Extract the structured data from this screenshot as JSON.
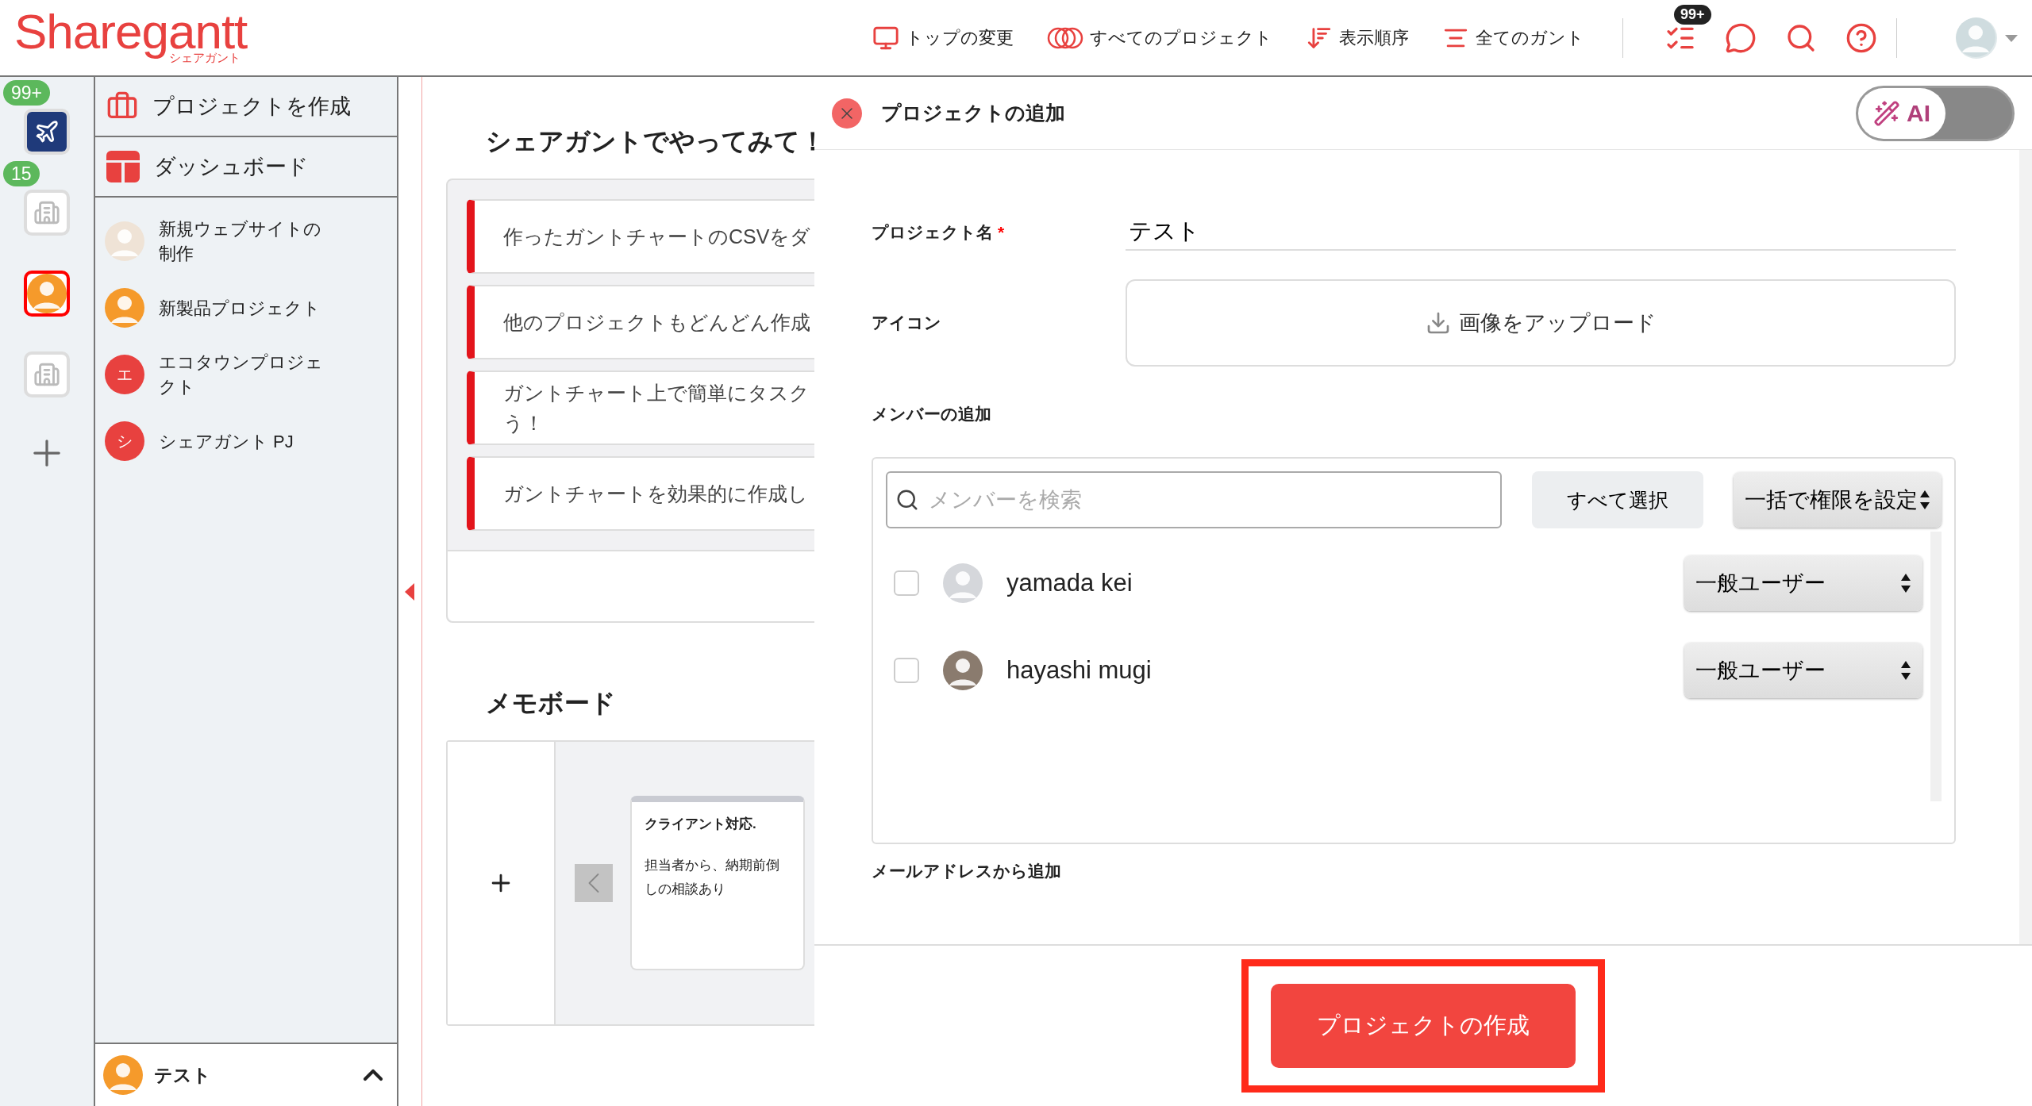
{
  "header": {
    "logo": {
      "name": "Sharegantt",
      "sub": "シェアガント"
    },
    "nav": [
      {
        "label": "トップの変更"
      },
      {
        "label": "すべてのプロジェクト"
      },
      {
        "label": "表示順序"
      },
      {
        "label": "全てのガント"
      }
    ],
    "tools": [
      {
        "badge": "99+"
      }
    ]
  },
  "rail": {
    "items": [
      {
        "kind": "plane",
        "badge": "99+",
        "selected": false
      },
      {
        "kind": "building",
        "badge": "15",
        "selected": false
      },
      {
        "kind": "character",
        "selected": true
      },
      {
        "kind": "building",
        "selected": false
      }
    ]
  },
  "sidebar": {
    "actions": [
      {
        "label": "プロジェクトを作成"
      },
      {
        "label": "ダッシュボード"
      }
    ],
    "projects": [
      {
        "name": "新規ウェブサイトの制作",
        "kind": "photo"
      },
      {
        "name": "新製品プロジェクト",
        "kind": "character"
      },
      {
        "name": "エコタウンプロジェクト",
        "kind": "letter",
        "letter": "エ"
      },
      {
        "name": "シェアガント PJ",
        "kind": "letter",
        "letter": "シ"
      }
    ],
    "current": "テスト"
  },
  "main": {
    "tips": {
      "title": "シェアガントでやってみて！",
      "items": [
        {
          "lines": [
            "作ったガントチャートのCSVをダ"
          ]
        },
        {
          "lines": [
            "他のプロジェクトもどんどん作成"
          ]
        },
        {
          "lines": [
            "ガントチャート上で簡単にタスク",
            "う！"
          ]
        },
        {
          "lines": [
            "ガントチャートを効果的に作成し"
          ]
        }
      ]
    },
    "memo": {
      "title": "メモボード",
      "cards": [
        {
          "title": "クライアント対応.",
          "body": "担当者から、納期前倒しの相談あり"
        }
      ]
    }
  },
  "dialog": {
    "title": "プロジェクトの追加",
    "ai_toggle": {
      "label": "AI",
      "on": false
    },
    "name_field": {
      "label": "プロジェクト名",
      "required_mark": "*",
      "value": "テスト"
    },
    "icon_field": {
      "label": "アイコン",
      "button": "画像をアップロード"
    },
    "members": {
      "label": "メンバーの追加",
      "search_placeholder": "メンバーを検索",
      "select_all": "すべて選択",
      "bulk_role": "一括で権限を設定",
      "list": [
        {
          "name": "yamada kei",
          "kind": "default",
          "checked": false,
          "role": "一般ユーザー"
        },
        {
          "name": "hayashi mugi",
          "kind": "photo",
          "checked": false,
          "role": "一般ユーザー"
        }
      ]
    },
    "email_label": "メールアドレスから追加",
    "submit": "プロジェクトの作成"
  }
}
